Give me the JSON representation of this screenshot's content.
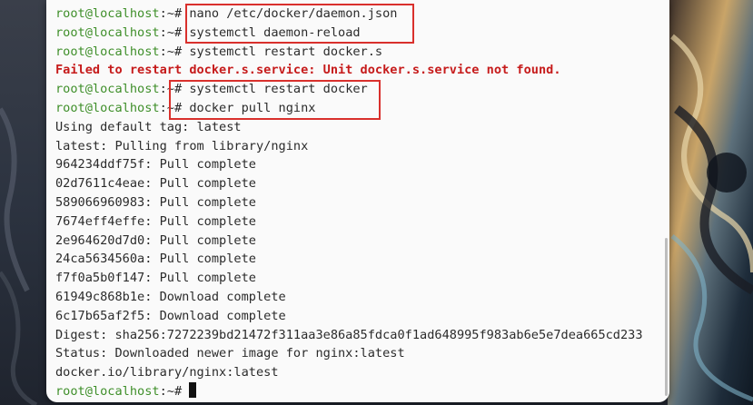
{
  "terminal": {
    "prompt": "root@localhost:~#",
    "colors": {
      "prompt": "#3f8f2a",
      "error": "#c61b1b",
      "highlight_box": "#d9302c",
      "background": "#fafafa",
      "text": "#2b2b2b"
    },
    "lines": [
      {
        "type": "command",
        "prompt_user": "root@localhost",
        "prompt_sep": ":~#",
        "text": " nano /etc/docker/daemon.json"
      },
      {
        "type": "command",
        "prompt_user": "root@localhost",
        "prompt_sep": ":~#",
        "text": " systemctl daemon-reload"
      },
      {
        "type": "command",
        "prompt_user": "root@localhost",
        "prompt_sep": ":~#",
        "text": " systemctl restart docker.s"
      },
      {
        "type": "error",
        "text": "Failed to restart docker.s.service: Unit docker.s.service not found."
      },
      {
        "type": "command",
        "prompt_user": "root@localhost",
        "prompt_sep": ":~#",
        "text": " systemctl restart docker"
      },
      {
        "type": "command",
        "prompt_user": "root@localhost",
        "prompt_sep": ":~#",
        "text": " docker pull nginx"
      },
      {
        "type": "output",
        "text": "Using default tag: latest"
      },
      {
        "type": "output",
        "text": "latest: Pulling from library/nginx"
      },
      {
        "type": "output",
        "text": "964234ddf75f: Pull complete"
      },
      {
        "type": "output",
        "text": "02d7611c4eae: Pull complete"
      },
      {
        "type": "output",
        "text": "589066960983: Pull complete"
      },
      {
        "type": "output",
        "text": "7674eff4effe: Pull complete"
      },
      {
        "type": "output",
        "text": "2e964620d7d0: Pull complete"
      },
      {
        "type": "output",
        "text": "24ca5634560a: Pull complete"
      },
      {
        "type": "output",
        "text": "f7f0a5b0f147: Pull complete"
      },
      {
        "type": "output",
        "text": "61949c868b1e: Download complete"
      },
      {
        "type": "output",
        "text": "6c17b65af2f5: Download complete"
      },
      {
        "type": "output",
        "text": "Digest: sha256:7272239bd21472f311aa3e86a85fdca0f1ad648995f983ab6e5e7dea665cd233"
      },
      {
        "type": "output",
        "text": "Status: Downloaded newer image for nginx:latest"
      },
      {
        "type": "output",
        "text": "docker.io/library/nginx:latest"
      },
      {
        "type": "command",
        "prompt_user": "root@localhost",
        "prompt_sep": ":~#",
        "text": " "
      }
    ]
  }
}
